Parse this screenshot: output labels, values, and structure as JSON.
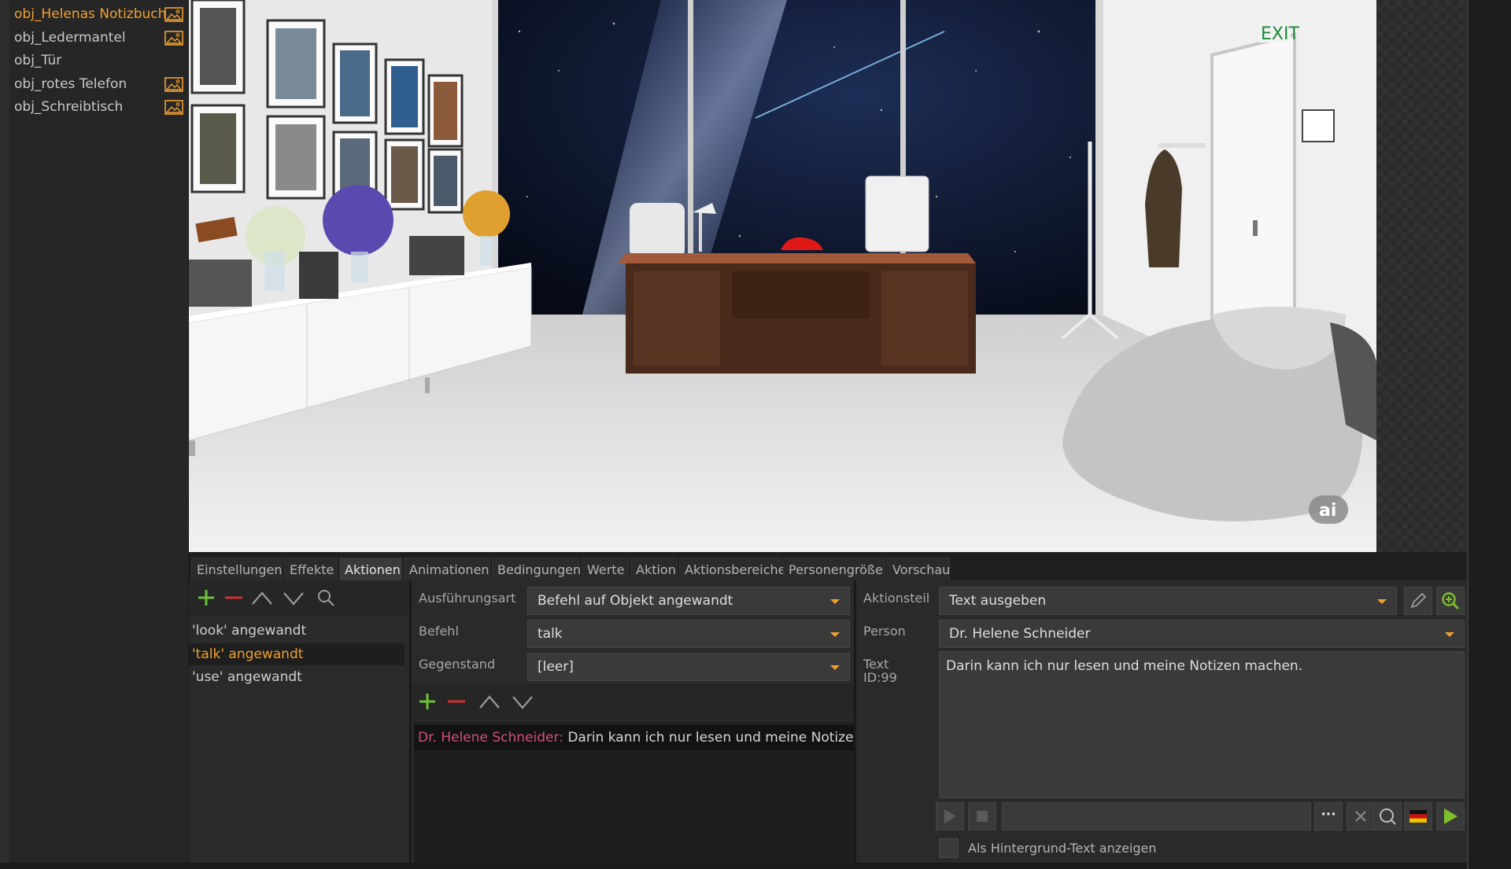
{
  "objects": [
    {
      "label": "obj_Helenas Notizbuch",
      "has_image": true,
      "active": true
    },
    {
      "label": "obj_Ledermantel",
      "has_image": true,
      "active": false
    },
    {
      "label": "obj_Tür",
      "has_image": false,
      "active": false
    },
    {
      "label": "obj_rotes Telefon",
      "has_image": true,
      "active": false
    },
    {
      "label": "obj_Schreibtisch",
      "has_image": true,
      "active": false
    }
  ],
  "scene": {
    "exit_sign": "EXIT",
    "watermark": "ai"
  },
  "tabs": [
    "Einstellungen",
    "Effekte",
    "Aktionen",
    "Animationen",
    "Bedingungen",
    "Werte",
    "Aktion",
    "Aktionsbereiche",
    "Personengröße",
    "Vorschau"
  ],
  "active_tab": "Aktionen",
  "actions": {
    "items": [
      "'look' angewandt",
      "'talk' angewandt",
      "'use' angewandt"
    ],
    "selected_index": 1
  },
  "middle": {
    "execution_label": "Ausführungsart",
    "execution_value": "Befehl auf Objekt angewandt",
    "command_label": "Befehl",
    "command_value": "talk",
    "object_label": "Gegenstand",
    "object_value": "[leer]",
    "dialog_speaker": "Dr. Helene Schneider",
    "dialog_separator": ":",
    "dialog_text": " Darin kann ich nur lesen und meine Notizen machen."
  },
  "right": {
    "action_part_label": "Aktionsteil",
    "action_part_value": "Text ausgeben",
    "person_label": "Person",
    "person_value": "Dr. Helene Schneider",
    "text_label": "Text",
    "text_id": "ID:99",
    "text_value": "Darin kann ich nur lesen und meine Notizen machen.",
    "more_label": "···",
    "checkbox_label": "Als Hintergrund-Text anzeigen"
  },
  "colors": {
    "accent": "#f0a030",
    "speaker": "#d0507a",
    "add": "#6ec03a",
    "remove": "#d03030",
    "play": "#7fbf2a"
  }
}
